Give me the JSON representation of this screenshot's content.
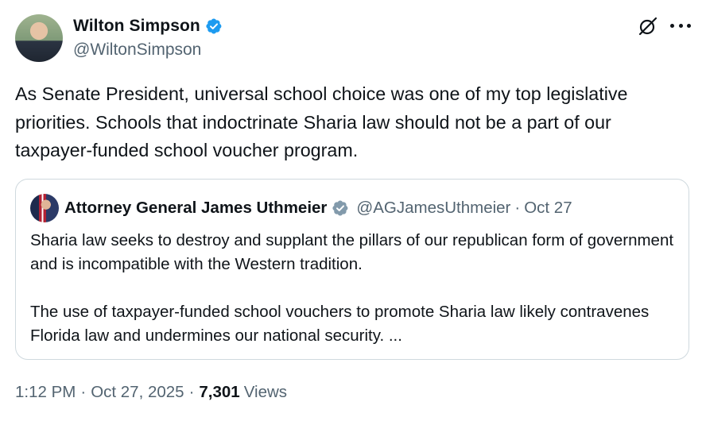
{
  "author": {
    "name": "Wilton Simpson",
    "handle": "@WiltonSimpson",
    "verified_color": "#1d9bf0"
  },
  "tweet": {
    "text": "As Senate President, universal school choice was one of my top legislative priorities. Schools that indoctrinate Sharia law should not be a part of our taxpayer-funded school voucher program."
  },
  "quote": {
    "name": "Attorney General James Uthmeier",
    "handle": "@AGJamesUthmeier",
    "separator": "·",
    "date": "Oct 27",
    "verified_color": "#829aab",
    "paragraphs": [
      "Sharia law seeks to destroy and supplant the pillars of our republican form of government and is incompatible with the Western tradition.",
      "The use of taxpayer-funded school vouchers to promote Sharia law likely contravenes Florida law and undermines our national security. ..."
    ]
  },
  "meta": {
    "time": "1:12 PM",
    "separator": "·",
    "date": "Oct 27, 2025",
    "views_count": "7,301",
    "views_label": "Views"
  },
  "icons": {
    "grok": "grok-icon",
    "more": "more-icon",
    "verified": "verified-badge-icon"
  }
}
